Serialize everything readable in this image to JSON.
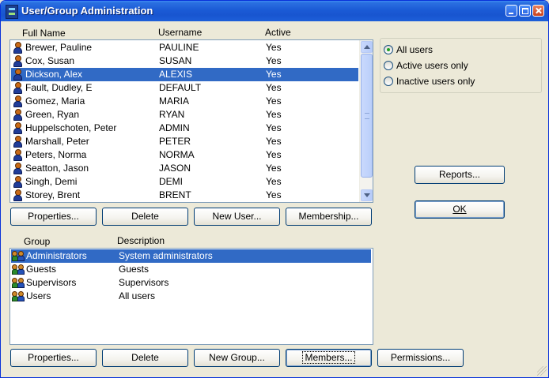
{
  "window": {
    "title": "User/Group Administration"
  },
  "users": {
    "headers": {
      "full_name": "Full Name",
      "username": "Username",
      "active": "Active"
    },
    "rows": [
      {
        "full_name": "Brewer, Pauline",
        "username": "PAULINE",
        "active": "Yes"
      },
      {
        "full_name": "Cox, Susan",
        "username": "SUSAN",
        "active": "Yes"
      },
      {
        "full_name": "Dickson, Alex",
        "username": "ALEXIS",
        "active": "Yes",
        "selected": true
      },
      {
        "full_name": "Fault, Dudley, E",
        "username": "DEFAULT",
        "active": "Yes"
      },
      {
        "full_name": "Gomez, Maria",
        "username": "MARIA",
        "active": "Yes"
      },
      {
        "full_name": "Green, Ryan",
        "username": "RYAN",
        "active": "Yes"
      },
      {
        "full_name": "Huppelschoten, Peter",
        "username": "ADMIN",
        "active": "Yes"
      },
      {
        "full_name": "Marshall, Peter",
        "username": "PETER",
        "active": "Yes"
      },
      {
        "full_name": "Peters, Norma",
        "username": "NORMA",
        "active": "Yes"
      },
      {
        "full_name": "Seatton, Jason",
        "username": "JASON",
        "active": "Yes"
      },
      {
        "full_name": "Singh, Demi",
        "username": "DEMI",
        "active": "Yes"
      },
      {
        "full_name": "Storey, Brent",
        "username": "BRENT",
        "active": "Yes"
      }
    ],
    "buttons": {
      "properties": "Properties...",
      "delete": "Delete",
      "new_user": "New User...",
      "membership": "Membership..."
    }
  },
  "filter": {
    "options": [
      "All users",
      "Active users only",
      "Inactive users only"
    ],
    "selected": "All users"
  },
  "side_buttons": {
    "reports": "Reports...",
    "ok": "OK"
  },
  "groups": {
    "headers": {
      "group": "Group",
      "description": "Description"
    },
    "rows": [
      {
        "group": "Administrators",
        "description": "System administrators",
        "selected": true
      },
      {
        "group": "Guests",
        "description": "Guests"
      },
      {
        "group": "Supervisors",
        "description": "Supervisors"
      },
      {
        "group": "Users",
        "description": "All users"
      }
    ],
    "buttons": {
      "properties": "Properties...",
      "delete": "Delete",
      "new_group": "New Group...",
      "members": "Members...",
      "permissions": "Permissions..."
    }
  },
  "colors": {
    "selection": "#316ac5",
    "titlebar": "#1b5bd6",
    "face": "#ece9d8"
  }
}
